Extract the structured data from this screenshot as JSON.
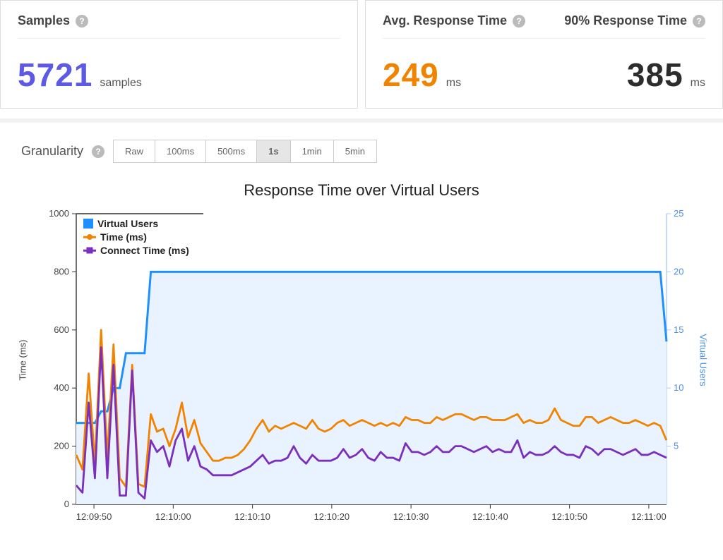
{
  "stats": {
    "samples": {
      "label": "Samples",
      "value": "5721",
      "unit": "samples"
    },
    "avg": {
      "label": "Avg. Response Time",
      "value": "249",
      "unit": "ms"
    },
    "p90": {
      "label": "90% Response Time",
      "value": "385",
      "unit": "ms"
    }
  },
  "granularity": {
    "label": "Granularity",
    "options": [
      "Raw",
      "100ms",
      "500ms",
      "1s",
      "1min",
      "5min"
    ],
    "selected": "1s"
  },
  "chart_data": {
    "type": "line",
    "title": "Response Time over Virtual Users",
    "x_ticks": [
      "12:09:50",
      "12:10:00",
      "12:10:10",
      "12:10:20",
      "12:10:30",
      "12:10:40",
      "12:10:50",
      "12:11:00"
    ],
    "left_axis": {
      "label": "Time (ms)",
      "ticks": [
        0,
        200,
        400,
        600,
        800,
        1000
      ]
    },
    "right_axis": {
      "label": "Virtual Users",
      "ticks": [
        5,
        10,
        15,
        20,
        25
      ]
    },
    "series": [
      {
        "name": "Virtual Users",
        "axis": "right",
        "color": "#1f8fff",
        "fill": true,
        "values": [
          7,
          7,
          7,
          7,
          8,
          8,
          10,
          10,
          13,
          13,
          13,
          13,
          20,
          20,
          20,
          20,
          20,
          20,
          20,
          20,
          20,
          20,
          20,
          20,
          20,
          20,
          20,
          20,
          20,
          20,
          20,
          20,
          20,
          20,
          20,
          20,
          20,
          20,
          20,
          20,
          20,
          20,
          20,
          20,
          20,
          20,
          20,
          20,
          20,
          20,
          20,
          20,
          20,
          20,
          20,
          20,
          20,
          20,
          20,
          20,
          20,
          20,
          20,
          20,
          20,
          20,
          20,
          20,
          20,
          20,
          20,
          20,
          20,
          20,
          20,
          20,
          20,
          20,
          20,
          20,
          20,
          20,
          20,
          20,
          20,
          20,
          20,
          20,
          20,
          20,
          20,
          20,
          20,
          20,
          20,
          14
        ]
      },
      {
        "name": "Time (ms)",
        "axis": "left",
        "color": "#f08400",
        "fill": false,
        "values": [
          170,
          120,
          450,
          140,
          600,
          160,
          550,
          90,
          60,
          480,
          70,
          60,
          310,
          250,
          260,
          200,
          260,
          350,
          230,
          290,
          210,
          180,
          150,
          150,
          160,
          160,
          170,
          190,
          220,
          260,
          290,
          250,
          270,
          260,
          270,
          280,
          270,
          260,
          290,
          260,
          250,
          260,
          280,
          290,
          270,
          280,
          290,
          280,
          270,
          280,
          270,
          280,
          270,
          300,
          290,
          290,
          280,
          280,
          300,
          290,
          300,
          310,
          310,
          300,
          290,
          300,
          300,
          290,
          290,
          290,
          300,
          310,
          280,
          290,
          280,
          280,
          290,
          330,
          290,
          280,
          270,
          270,
          300,
          300,
          280,
          290,
          300,
          290,
          280,
          280,
          290,
          280,
          270,
          280,
          270,
          220
        ]
      },
      {
        "name": "Connect Time (ms)",
        "axis": "left",
        "color": "#7a2fbd",
        "fill": false,
        "values": [
          65,
          40,
          350,
          90,
          540,
          90,
          480,
          30,
          30,
          460,
          40,
          20,
          220,
          180,
          200,
          130,
          220,
          260,
          150,
          200,
          130,
          120,
          100,
          100,
          100,
          100,
          110,
          120,
          130,
          150,
          170,
          140,
          150,
          150,
          160,
          200,
          160,
          140,
          170,
          150,
          150,
          150,
          160,
          190,
          160,
          170,
          190,
          160,
          150,
          180,
          160,
          160,
          150,
          210,
          180,
          180,
          170,
          180,
          200,
          180,
          180,
          200,
          200,
          190,
          180,
          190,
          200,
          180,
          190,
          180,
          180,
          220,
          160,
          180,
          170,
          170,
          180,
          200,
          180,
          170,
          170,
          160,
          200,
          190,
          170,
          190,
          190,
          180,
          170,
          180,
          190,
          170,
          170,
          180,
          170,
          160
        ]
      }
    ]
  }
}
